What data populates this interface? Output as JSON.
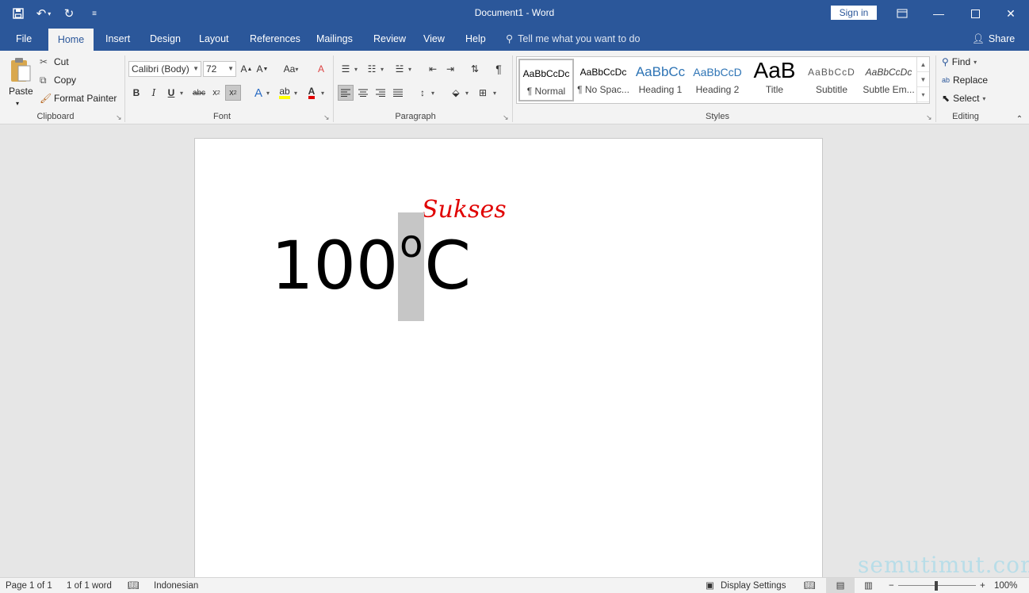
{
  "title_bar": {
    "title": "Document1  -  Word",
    "sign_in": "Sign in"
  },
  "tabs": [
    {
      "label": "File"
    },
    {
      "label": "Home"
    },
    {
      "label": "Insert"
    },
    {
      "label": "Design"
    },
    {
      "label": "Layout"
    },
    {
      "label": "References"
    },
    {
      "label": "Mailings"
    },
    {
      "label": "Review"
    },
    {
      "label": "View"
    },
    {
      "label": "Help"
    }
  ],
  "tell_me": "Tell me what you want to do",
  "share": "Share",
  "clipboard": {
    "paste": "Paste",
    "cut": "Cut",
    "copy": "Copy",
    "format_painter": "Format Painter",
    "label": "Clipboard"
  },
  "font": {
    "name": "Calibri (Body)",
    "size": "72",
    "label": "Font"
  },
  "paragraph": {
    "label": "Paragraph"
  },
  "styles": {
    "label": "Styles",
    "items": [
      {
        "preview": "AaBbCcDc",
        "label": "¶ Normal"
      },
      {
        "preview": "AaBbCcDc",
        "label": "¶ No Spac..."
      },
      {
        "preview": "AaBbCc",
        "label": "Heading 1"
      },
      {
        "preview": "AaBbCcD",
        "label": "Heading 2"
      },
      {
        "preview": "AaB",
        "label": "Title"
      },
      {
        "preview": "AaBbCcD",
        "label": "Subtitle"
      },
      {
        "preview": "AaBbCcDc",
        "label": "Subtle Em..."
      }
    ]
  },
  "editing": {
    "find": "Find",
    "replace": "Replace",
    "select": "Select",
    "label": "Editing"
  },
  "document": {
    "text_main": "100",
    "text_superscript": "o",
    "text_after": "C",
    "annotation": "Sukses",
    "watermark": "semutimut.com"
  },
  "status": {
    "page": "Page 1 of 1",
    "words": "1 of 1 word",
    "language": "Indonesian",
    "display_settings": "Display Settings",
    "zoom": "100%"
  },
  "colors": {
    "accent": "#2b579a",
    "annotation": "#e00000",
    "selection": "#c6c6c6"
  }
}
